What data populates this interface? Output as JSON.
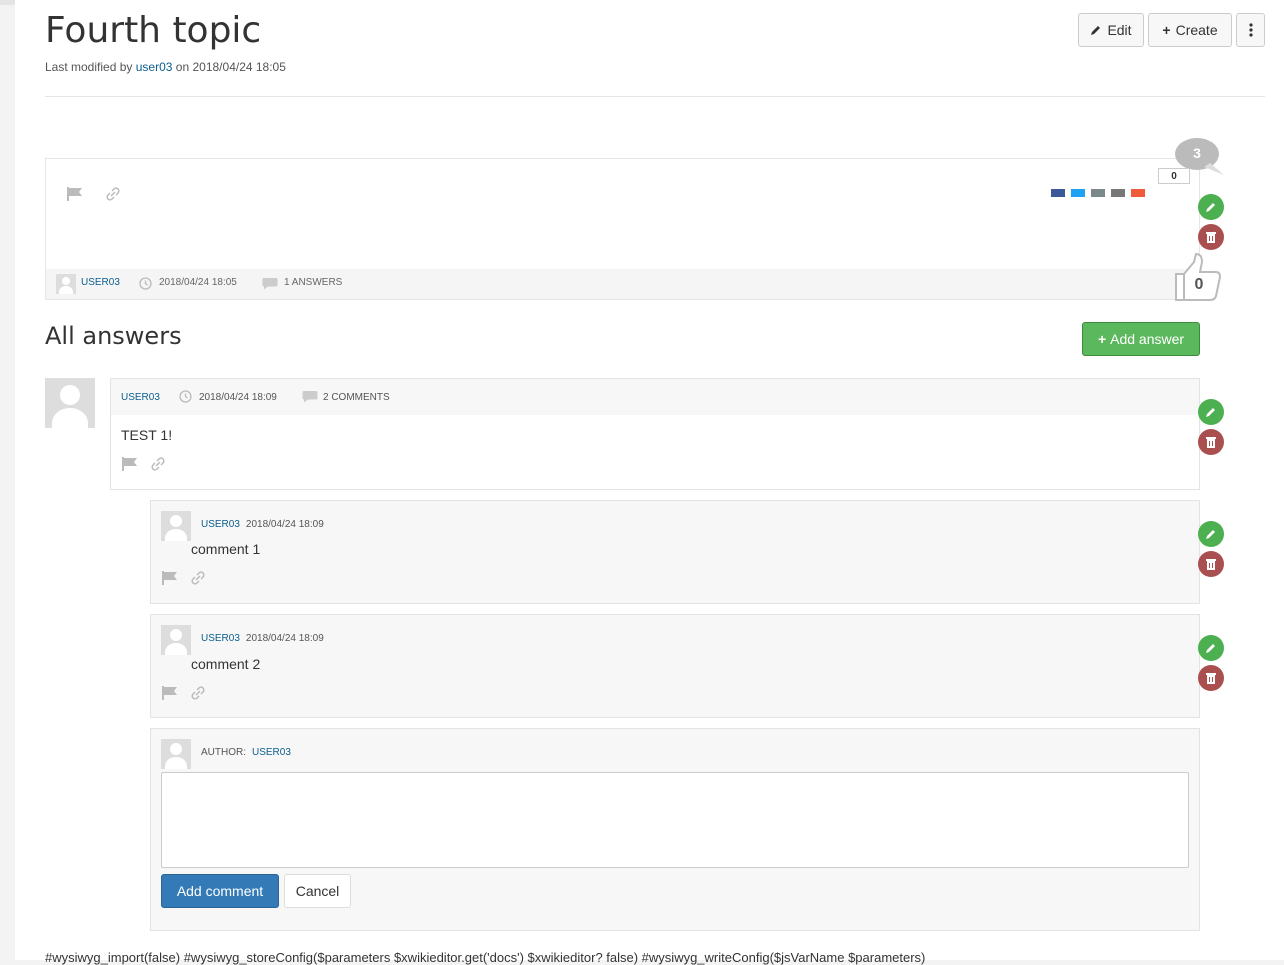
{
  "page": {
    "title": "Fourth topic",
    "modified_prefix": "Last modified by",
    "modified_user": "user03",
    "modified_on": "on",
    "modified_date": "2018/04/24 18:05"
  },
  "toolbar": {
    "edit_label": "Edit",
    "create_label": "Create"
  },
  "question": {
    "comment_count": "3",
    "counter": "0",
    "vote_count": "0",
    "author": "USER03",
    "date": "2018/04/24 18:05",
    "answers_count": "1 ANSWERS",
    "icons": [
      "flag-icon",
      "link-icon",
      "facebook-icon",
      "twitter-icon",
      "print-icon",
      "email-icon",
      "plus-share-icon"
    ]
  },
  "answers": {
    "heading": "All answers",
    "add_answer_label": "Add answer",
    "items": [
      {
        "author": "USER03",
        "date": "2018/04/24 18:09",
        "comments_count": "2 COMMENTS",
        "text": "TEST 1!"
      }
    ]
  },
  "comments": [
    {
      "author": "USER03",
      "date": "2018/04/24 18:09",
      "text": "comment 1"
    },
    {
      "author": "USER03",
      "date": "2018/04/24 18:09",
      "text": "comment 2"
    }
  ],
  "comment_form": {
    "author_label": "AUTHOR:",
    "author": "USER03",
    "submit_label": "Add comment",
    "cancel_label": "Cancel"
  },
  "footer": {
    "code_text": "#wysiwyg_import(false) #wysiwyg_storeConfig($parameters $xwikieditor.get('docs') $xwikieditor? false) #wysiwyg_writeConfig($jsVarName $parameters)"
  },
  "colors": {
    "link": "#0b5e8e",
    "green": "#4caf50",
    "red": "#a94f4f",
    "primary": "#337ab7",
    "success": "#5cb85c"
  }
}
